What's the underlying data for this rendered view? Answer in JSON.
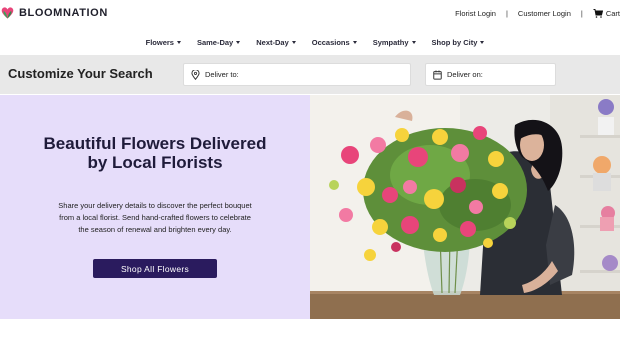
{
  "brand": {
    "name": "BLOOMNATION"
  },
  "header": {
    "florist_login": "Florist Login",
    "customer_login": "Customer Login",
    "separator": "|",
    "cart": "Cart",
    "cart_icon": "cart-icon"
  },
  "nav": {
    "items": [
      {
        "label": "Flowers"
      },
      {
        "label": "Same-Day"
      },
      {
        "label": "Next-Day"
      },
      {
        "label": "Occasions"
      },
      {
        "label": "Sympathy"
      },
      {
        "label": "Shop by City"
      }
    ]
  },
  "search": {
    "title": "Customize Your Search",
    "deliver_to": {
      "label": "Deliver to:",
      "icon": "location-pin-icon"
    },
    "deliver_on": {
      "label": "Deliver on:",
      "icon": "calendar-icon"
    }
  },
  "hero": {
    "headline": "Beautiful Flowers Delivered by Local Florists",
    "body": "Share your delivery details to discover the perfect bouquet from a local florist. Send hand-crafted flowers to celebrate the season of renewal and brighten every day.",
    "cta": "Shop All Flowers",
    "image": "florist-arranging-bouquet-photo"
  },
  "colors": {
    "hero_bg": "#e6ddfa",
    "cta_bg": "#2a1b5e",
    "search_bar_bg": "#e8e8e8",
    "logo_green": "#3aa55a",
    "logo_pink": "#e8457a"
  }
}
